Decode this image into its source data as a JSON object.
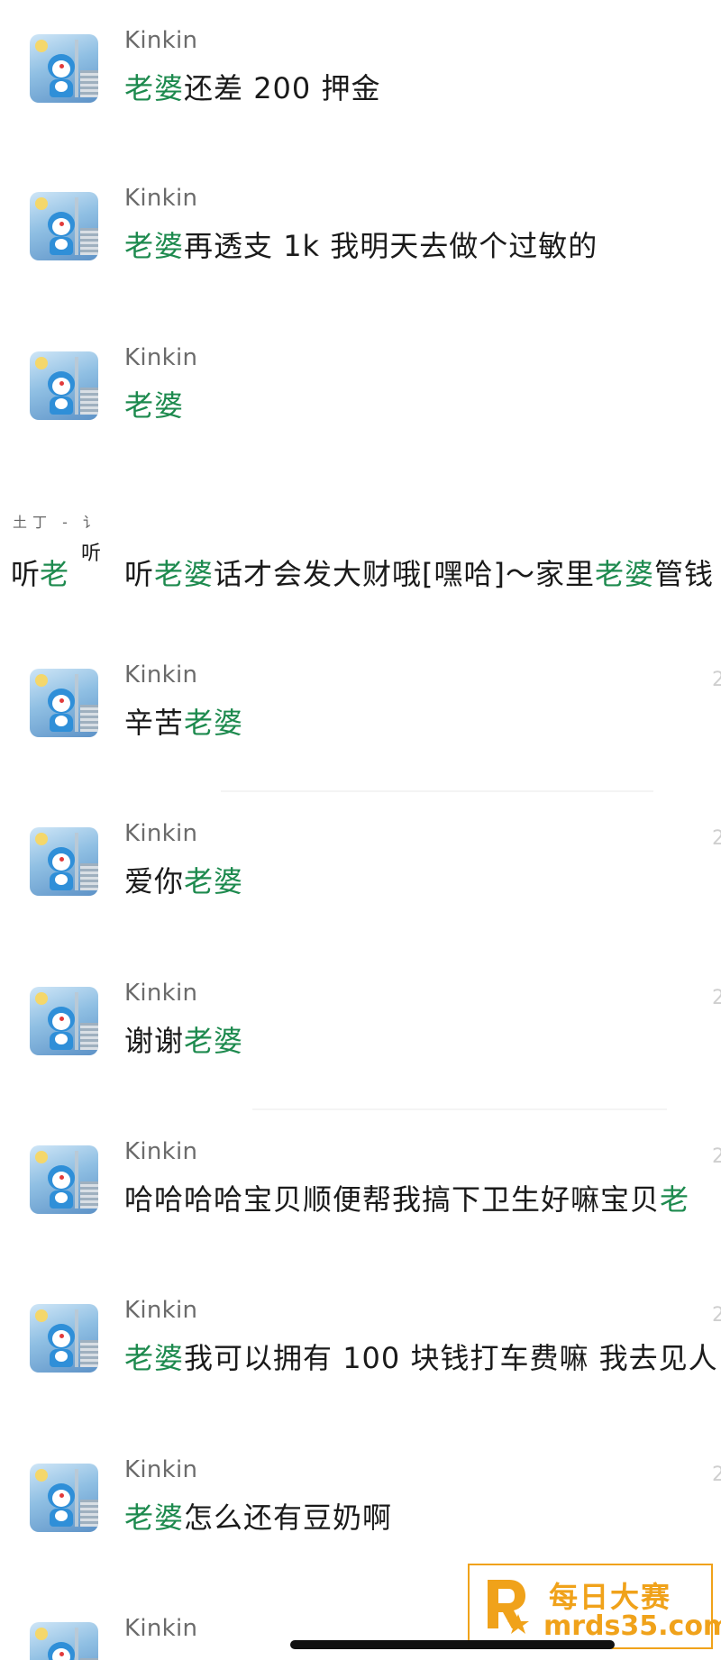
{
  "messages": [
    {
      "name": "Kinkin",
      "segments": [
        {
          "t": "老婆",
          "hl": true
        },
        {
          "t": "还差 200 押金",
          "hl": false
        }
      ]
    },
    {
      "name": "Kinkin",
      "segments": [
        {
          "t": "老婆",
          "hl": true
        },
        {
          "t": "再透支 1k 我明天去做个过敏的",
          "hl": false
        }
      ]
    },
    {
      "name": "Kinkin",
      "segments": [
        {
          "t": "老婆",
          "hl": true
        }
      ]
    },
    {
      "name": "Kinkin",
      "segments": [
        {
          "t": "辛苦",
          "hl": false
        },
        {
          "t": "老婆",
          "hl": true
        }
      ]
    },
    {
      "name": "Kinkin",
      "segments": [
        {
          "t": "爱你",
          "hl": false
        },
        {
          "t": "老婆",
          "hl": true
        }
      ]
    },
    {
      "name": "Kinkin",
      "segments": [
        {
          "t": "谢谢",
          "hl": false
        },
        {
          "t": "老婆",
          "hl": true
        }
      ]
    },
    {
      "name": "Kinkin",
      "segments": [
        {
          "t": "哈哈哈哈宝贝顺便帮我搞下卫生好嘛宝贝",
          "hl": false
        },
        {
          "t": "老",
          "hl": true
        }
      ]
    },
    {
      "name": "Kinkin",
      "segments": [
        {
          "t": "老婆",
          "hl": true
        },
        {
          "t": "我可以拥有 100 块钱打车费嘛 我去见人",
          "hl": false
        }
      ]
    },
    {
      "name": "Kinkin",
      "segments": [
        {
          "t": "老婆",
          "hl": true
        },
        {
          "t": "怎么还有豆奶啊",
          "hl": false
        }
      ]
    },
    {
      "name": "Kinkin",
      "segments": []
    }
  ],
  "partial_row": {
    "left_top": "土丁 - 讠",
    "left_text_1": "听",
    "left_text_2": "老",
    "left_frag": "听",
    "segments": [
      {
        "t": "听",
        "hl": false
      },
      {
        "t": "老婆",
        "hl": true
      },
      {
        "t": "话才会发大财哦[嘿哈]～家里",
        "hl": false
      },
      {
        "t": "老婆",
        "hl": true
      },
      {
        "t": "管钱",
        "hl": false
      }
    ]
  },
  "watermark": {
    "line1": "每日大赛",
    "line2": "mrds35.com"
  },
  "colors": {
    "highlight": "#1d8a4e",
    "name_gray": "#6b6b6b",
    "watermark": "#f0a21a"
  },
  "icons": {
    "avatar": "doraemon-avatar-icon",
    "watermark_logo": "r-star-logo-icon"
  }
}
